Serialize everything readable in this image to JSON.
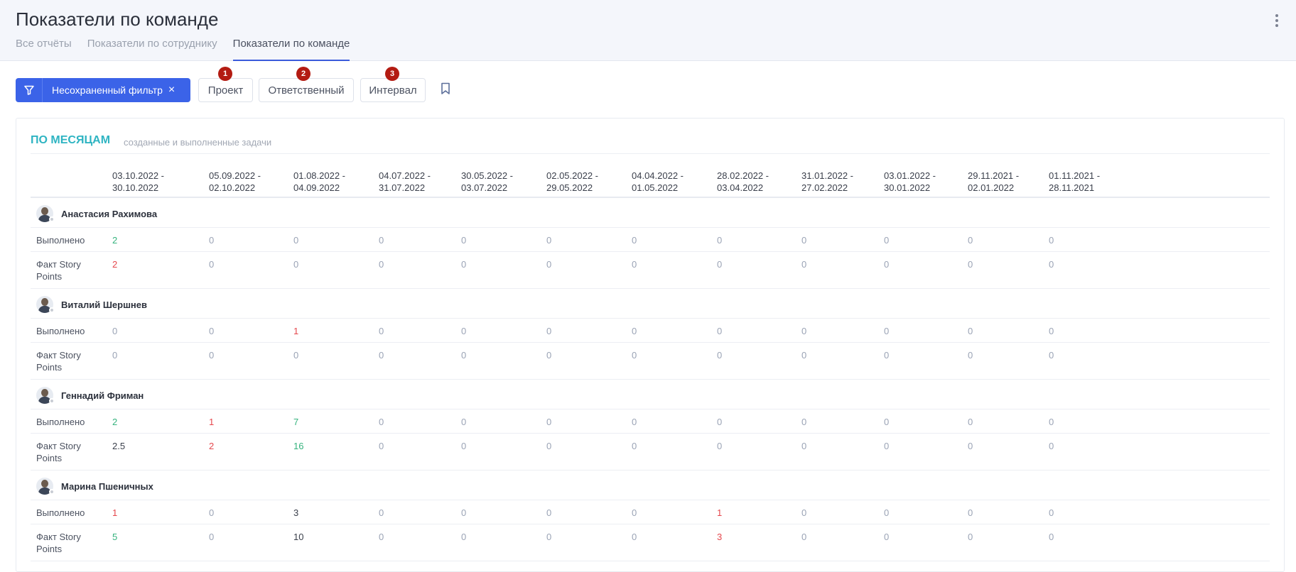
{
  "header": {
    "title": "Показатели по команде",
    "tabs": [
      {
        "label": "Все отчёты",
        "active": false
      },
      {
        "label": "Показатели по сотруднику",
        "active": false
      },
      {
        "label": "Показатели по команде",
        "active": true
      }
    ]
  },
  "filters": {
    "main_label": "Несохраненный фильтр",
    "main_close": "×",
    "buttons": [
      {
        "label": "Проект",
        "badge": "1"
      },
      {
        "label": "Ответственный",
        "badge": "2"
      },
      {
        "label": "Интервал",
        "badge": "3"
      }
    ]
  },
  "report": {
    "title": "ПО МЕСЯЦАМ",
    "subtitle": "созданные и выполненные задачи",
    "periods": [
      "03.10.2022 -\n30.10.2022",
      "05.09.2022 -\n02.10.2022",
      "01.08.2022 -\n04.09.2022",
      "04.07.2022 -\n31.07.2022",
      "30.05.2022 -\n03.07.2022",
      "02.05.2022 -\n29.05.2022",
      "04.04.2022 -\n01.05.2022",
      "28.02.2022 -\n03.04.2022",
      "31.01.2022 -\n27.02.2022",
      "03.01.2022 -\n30.01.2022",
      "29.11.2021 -\n02.01.2022",
      "01.11.2021 -\n28.11.2021"
    ],
    "metric_labels": [
      "Выполнено",
      "Факт Story\nPoints"
    ],
    "people": [
      {
        "name": "Анастасия Рахимова",
        "done": [
          {
            "v": "2",
            "c": "green"
          },
          {
            "v": "0",
            "c": "zero"
          },
          {
            "v": "0",
            "c": "zero"
          },
          {
            "v": "0",
            "c": "zero"
          },
          {
            "v": "0",
            "c": "zero"
          },
          {
            "v": "0",
            "c": "zero"
          },
          {
            "v": "0",
            "c": "zero"
          },
          {
            "v": "0",
            "c": "zero"
          },
          {
            "v": "0",
            "c": "zero"
          },
          {
            "v": "0",
            "c": "zero"
          },
          {
            "v": "0",
            "c": "zero"
          },
          {
            "v": "0",
            "c": "zero"
          }
        ],
        "sp": [
          {
            "v": "2",
            "c": "red"
          },
          {
            "v": "0",
            "c": "zero"
          },
          {
            "v": "0",
            "c": "zero"
          },
          {
            "v": "0",
            "c": "zero"
          },
          {
            "v": "0",
            "c": "zero"
          },
          {
            "v": "0",
            "c": "zero"
          },
          {
            "v": "0",
            "c": "zero"
          },
          {
            "v": "0",
            "c": "zero"
          },
          {
            "v": "0",
            "c": "zero"
          },
          {
            "v": "0",
            "c": "zero"
          },
          {
            "v": "0",
            "c": "zero"
          },
          {
            "v": "0",
            "c": "zero"
          }
        ]
      },
      {
        "name": "Виталий Шершнев",
        "done": [
          {
            "v": "0",
            "c": "zero"
          },
          {
            "v": "0",
            "c": "zero"
          },
          {
            "v": "1",
            "c": "red"
          },
          {
            "v": "0",
            "c": "zero"
          },
          {
            "v": "0",
            "c": "zero"
          },
          {
            "v": "0",
            "c": "zero"
          },
          {
            "v": "0",
            "c": "zero"
          },
          {
            "v": "0",
            "c": "zero"
          },
          {
            "v": "0",
            "c": "zero"
          },
          {
            "v": "0",
            "c": "zero"
          },
          {
            "v": "0",
            "c": "zero"
          },
          {
            "v": "0",
            "c": "zero"
          }
        ],
        "sp": [
          {
            "v": "0",
            "c": "zero"
          },
          {
            "v": "0",
            "c": "zero"
          },
          {
            "v": "0",
            "c": "zero"
          },
          {
            "v": "0",
            "c": "zero"
          },
          {
            "v": "0",
            "c": "zero"
          },
          {
            "v": "0",
            "c": "zero"
          },
          {
            "v": "0",
            "c": "zero"
          },
          {
            "v": "0",
            "c": "zero"
          },
          {
            "v": "0",
            "c": "zero"
          },
          {
            "v": "0",
            "c": "zero"
          },
          {
            "v": "0",
            "c": "zero"
          },
          {
            "v": "0",
            "c": "zero"
          }
        ]
      },
      {
        "name": "Геннадий Фриман",
        "done": [
          {
            "v": "2",
            "c": "green"
          },
          {
            "v": "1",
            "c": "red"
          },
          {
            "v": "7",
            "c": "green"
          },
          {
            "v": "0",
            "c": "zero"
          },
          {
            "v": "0",
            "c": "zero"
          },
          {
            "v": "0",
            "c": "zero"
          },
          {
            "v": "0",
            "c": "zero"
          },
          {
            "v": "0",
            "c": "zero"
          },
          {
            "v": "0",
            "c": "zero"
          },
          {
            "v": "0",
            "c": "zero"
          },
          {
            "v": "0",
            "c": "zero"
          },
          {
            "v": "0",
            "c": "zero"
          }
        ],
        "sp": [
          {
            "v": "2.5",
            "c": "dark"
          },
          {
            "v": "2",
            "c": "red"
          },
          {
            "v": "16",
            "c": "green"
          },
          {
            "v": "0",
            "c": "zero"
          },
          {
            "v": "0",
            "c": "zero"
          },
          {
            "v": "0",
            "c": "zero"
          },
          {
            "v": "0",
            "c": "zero"
          },
          {
            "v": "0",
            "c": "zero"
          },
          {
            "v": "0",
            "c": "zero"
          },
          {
            "v": "0",
            "c": "zero"
          },
          {
            "v": "0",
            "c": "zero"
          },
          {
            "v": "0",
            "c": "zero"
          }
        ]
      },
      {
        "name": "Марина Пшеничных",
        "done": [
          {
            "v": "1",
            "c": "red"
          },
          {
            "v": "0",
            "c": "zero"
          },
          {
            "v": "3",
            "c": "dark"
          },
          {
            "v": "0",
            "c": "zero"
          },
          {
            "v": "0",
            "c": "zero"
          },
          {
            "v": "0",
            "c": "zero"
          },
          {
            "v": "0",
            "c": "zero"
          },
          {
            "v": "1",
            "c": "red"
          },
          {
            "v": "0",
            "c": "zero"
          },
          {
            "v": "0",
            "c": "zero"
          },
          {
            "v": "0",
            "c": "zero"
          },
          {
            "v": "0",
            "c": "zero"
          }
        ],
        "sp": [
          {
            "v": "5",
            "c": "green"
          },
          {
            "v": "0",
            "c": "zero"
          },
          {
            "v": "10",
            "c": "dark"
          },
          {
            "v": "0",
            "c": "zero"
          },
          {
            "v": "0",
            "c": "zero"
          },
          {
            "v": "0",
            "c": "zero"
          },
          {
            "v": "0",
            "c": "zero"
          },
          {
            "v": "3",
            "c": "red"
          },
          {
            "v": "0",
            "c": "zero"
          },
          {
            "v": "0",
            "c": "zero"
          },
          {
            "v": "0",
            "c": "zero"
          },
          {
            "v": "0",
            "c": "zero"
          }
        ]
      }
    ]
  },
  "colors": {
    "accent": "#3b63e8",
    "title_teal": "#2eb4c2",
    "positive": "#36b37e",
    "negative": "#e5484d",
    "zero": "#9aa3b5",
    "badge": "#b31b12"
  },
  "icons": {
    "filter": "filter-icon",
    "bookmark": "bookmark-icon",
    "menu": "more-vertical-icon"
  }
}
